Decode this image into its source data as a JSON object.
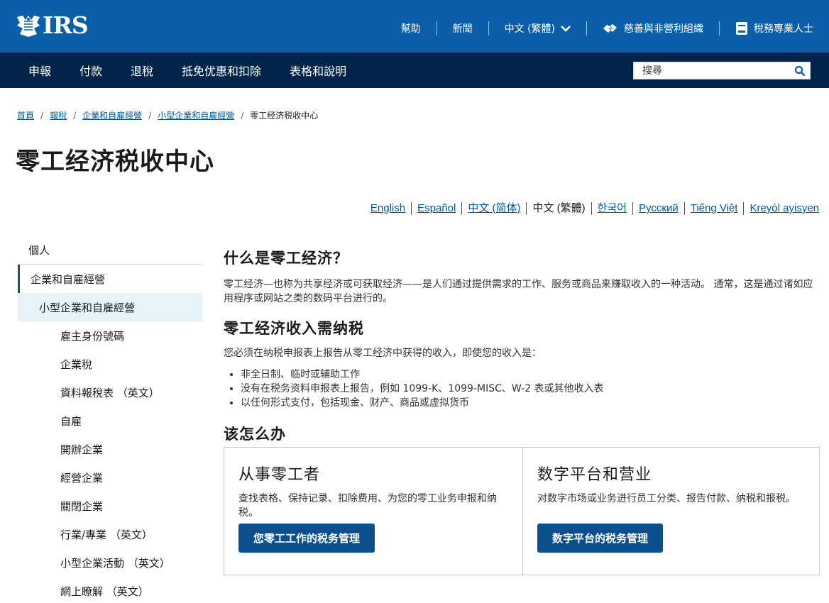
{
  "header": {
    "logo_text": "IRS",
    "top_links": [
      {
        "label": "幫助"
      },
      {
        "label": "新聞"
      },
      {
        "label": "中文 (繁體)"
      },
      {
        "label": "慈善與非營利組織"
      },
      {
        "label": "稅務專業人士"
      }
    ]
  },
  "nav": {
    "items": [
      "申報",
      "付款",
      "退稅",
      "抵免优惠和扣除",
      "表格和說明"
    ],
    "search_placeholder": "搜尋"
  },
  "breadcrumb": {
    "links": [
      "首頁",
      "報稅",
      "企業和自雇經營",
      "小型企業和自雇經營"
    ],
    "current": "零工经济税收中心"
  },
  "page_title": "零工经济税收中心",
  "languages": [
    {
      "label": "English",
      "current": false
    },
    {
      "label": "Español",
      "current": false
    },
    {
      "label": "中文 (简体)",
      "current": false
    },
    {
      "label": "中文 (繁體)",
      "current": true
    },
    {
      "label": "한국어",
      "current": false
    },
    {
      "label": "Русский",
      "current": false
    },
    {
      "label": "Tiếng Việt",
      "current": false
    },
    {
      "label": "Kreyòl ayisyen",
      "current": false
    }
  ],
  "sidebar": {
    "top": "個人",
    "section": "企業和自雇經營",
    "active": "小型企業和自雇經營",
    "items": [
      "雇主身份號碼",
      "企業稅",
      "資料報稅表 （英文）",
      "自雇",
      "開辦企業",
      "經營企業",
      "關閉企業",
      "行業/專業 （英文）",
      "小型企業活動 （英文）",
      "網上瞭解 （英文）"
    ]
  },
  "content": {
    "h1": "什么是零工经济？",
    "p1": "零工经济—也称为共享经济或可获取经济——是人们通过提供需求的工作、服务或商品来赚取收入的一种活动。 通常，这是通过诸如应用程序或网站之类的数码平台进行的。",
    "h2": "零工经济收入需纳税",
    "p2": "您必须在纳税申报表上报告从零工经济中获得的收入，即使您的收入是：",
    "list": [
      "非全日制、临时或辅助工作",
      "没有在税务资料申报表上报告，例如 1099-K、1099-MISC、W-2 表或其他收入表",
      "以任何形式支付，包括现金、财产、商品或虚拟货币"
    ],
    "h3": "该怎么办"
  },
  "cards": [
    {
      "title": "从事零工者",
      "desc": "查找表格、保持记录、扣除费用、为您的零工业务申报和纳税。",
      "button": "您零工工作的税务管理"
    },
    {
      "title": "数字平台和营业",
      "desc": "对数字市场或业务进行员工分类、报告付款、纳税和报税。",
      "button": "数字平台的税务管理"
    }
  ],
  "colors": {
    "top_bar": "#0b5ea8",
    "nav_bar": "#00244a",
    "link": "#00599c",
    "button": "#0b4f8c",
    "sidebar_active_bg": "#e6f4fa"
  }
}
